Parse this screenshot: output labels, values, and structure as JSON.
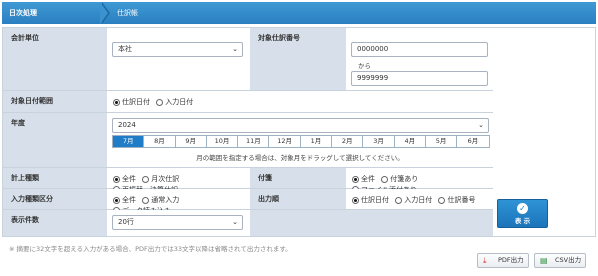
{
  "breadcrumb": {
    "parent": "日次処理",
    "current": "仕訳帳"
  },
  "form": {
    "company_unit": {
      "label": "会計単位",
      "value": "本社"
    },
    "target_journal_no": {
      "label": "対象仕訳番号",
      "from_value": "0000000",
      "from_word": "から",
      "to_value": "9999999"
    },
    "target_date_range": {
      "label": "対象日付範囲",
      "options": [
        "仕訳日付",
        "入力日付"
      ],
      "selected": 0
    },
    "fiscal_year": {
      "label": "年度",
      "value": "2024",
      "months": [
        "7月",
        "8月",
        "9月",
        "10月",
        "11月",
        "12月",
        "1月",
        "2月",
        "3月",
        "4月",
        "5月",
        "6月"
      ],
      "selected_month": 0,
      "hint": "月の範囲を指定する場合は、対象月をドラッグして選択してください。"
    },
    "posting_type": {
      "label": "計上種類",
      "options": [
        "全件",
        "月次仕訳",
        "再振替・決算仕訳"
      ],
      "selected": 0
    },
    "attachment": {
      "label": "付箋",
      "options": [
        "全件",
        "付箋あり",
        "ファイル添付あり"
      ],
      "selected": 0
    },
    "input_type": {
      "label": "入力種類区分",
      "options": [
        "全件",
        "通常入力",
        "データ読み込み"
      ],
      "selected": 0
    },
    "output_order": {
      "label": "出力順",
      "options": [
        "仕訳日付",
        "入力日付",
        "仕訳番号"
      ],
      "selected": 0
    },
    "display_count": {
      "label": "表示件数",
      "value": "20行"
    }
  },
  "show_button": {
    "label": "表 示"
  },
  "footnote": "※ 摘要に32文字を超える入力がある場合、PDF出力では33文字以降は省略されて出力されます。",
  "export": {
    "pdf_label": "PDF出力",
    "csv_label": "CSV出力"
  },
  "colors": {
    "accent": "#1f7cc6",
    "label_bg": "#d7e0ea"
  }
}
